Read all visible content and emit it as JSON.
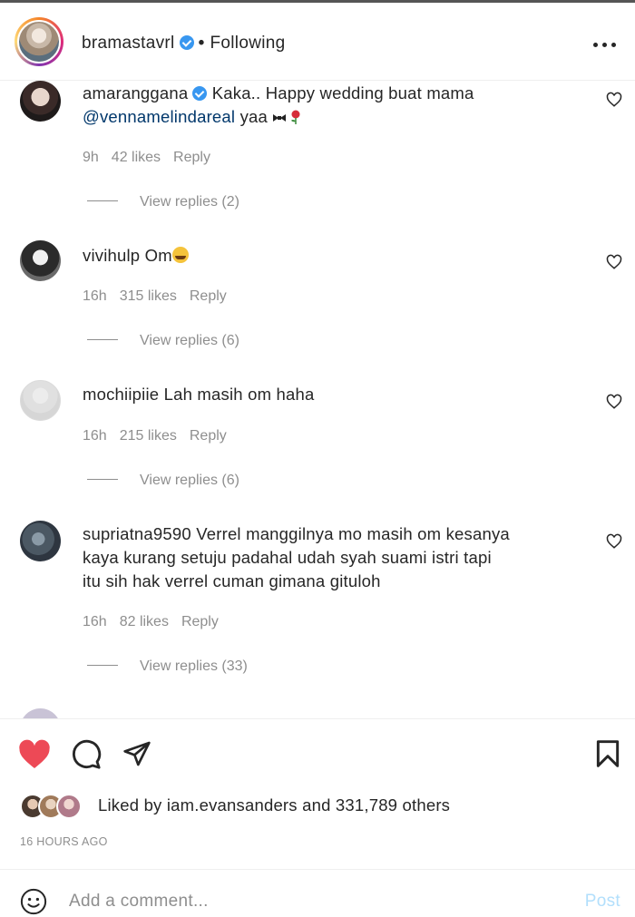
{
  "header": {
    "username": "bramastavrl",
    "separator": "•",
    "follow_status": "Following",
    "verified_icon": "verified-badge-icon",
    "more_icon": "more-options-icon"
  },
  "comments": [
    {
      "username": "amaranggana",
      "verified": true,
      "text_before": "Kaka.. Happy wedding buat mama",
      "mention": "@vennamelindareal",
      "text_after": "yaa",
      "emojis": [
        "ribbon-emoji",
        "rose-emoji"
      ],
      "time": "9h",
      "likes": "42 likes",
      "reply": "Reply",
      "view_replies": "View replies (2)"
    },
    {
      "username": "vivihulp",
      "text": "Om",
      "emojis": [
        "laughing-face-emoji"
      ],
      "time": "16h",
      "likes": "315 likes",
      "reply": "Reply",
      "view_replies": "View replies (6)"
    },
    {
      "username": "mochiipiie",
      "text": "Lah masih om haha",
      "time": "16h",
      "likes": "215 likes",
      "reply": "Reply",
      "view_replies": "View replies (6)"
    },
    {
      "username": "supriatna9590",
      "text_line1": "Verrel manggilnya mo masih om kesanya",
      "text_line2": "kaya kurang setuju padahal udah syah suami istri tapi",
      "text_line3": "itu sih hak verrel cuman gimana gituloh",
      "time": "16h",
      "likes": "82 likes",
      "reply": "Reply",
      "view_replies": "View replies (33)"
    }
  ],
  "actions": {
    "like_icon": "heart-filled-icon",
    "comment_icon": "comment-bubble-icon",
    "share_icon": "send-icon",
    "save_icon": "bookmark-icon",
    "liked_by_prefix": "Liked by",
    "liked_by_user": "iam.evansanders",
    "liked_by_suffix": "and 331,789 others",
    "time_ago": "16 HOURS AGO"
  },
  "add_comment": {
    "placeholder": "Add a comment...",
    "post_label": "Post",
    "emoji_icon": "smiley-face-icon"
  },
  "colors": {
    "like_red": "#ed4956",
    "verified_blue": "#3897f0",
    "mention_blue": "#00376b",
    "meta_gray": "#8e8e8e",
    "post_disabled": "#b2dffc"
  }
}
